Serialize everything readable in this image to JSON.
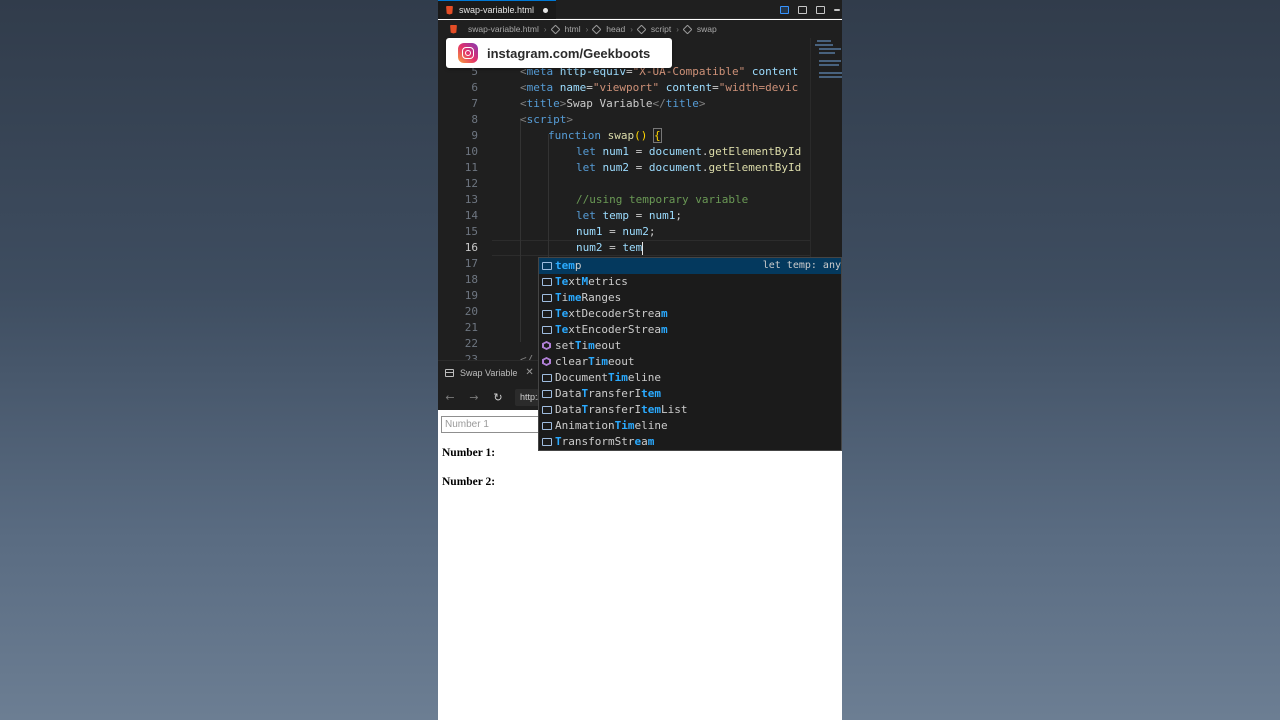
{
  "editor_tab": {
    "filename": "swap-variable.html"
  },
  "breadcrumbs": [
    "swap-variable.html",
    "html",
    "head",
    "script",
    "swap"
  ],
  "banner": {
    "text": "instagram.com/Geekboots"
  },
  "gutter": [
    "5",
    "6",
    "7",
    "8",
    "9",
    "10",
    "11",
    "12",
    "13",
    "14",
    "15",
    "16",
    "17",
    "18",
    "19",
    "20",
    "21",
    "22",
    "23"
  ],
  "code": {
    "l5": [
      "<",
      "meta",
      " ",
      "http-equiv",
      "=",
      "\"X-UA-Compatible\"",
      " ",
      "content"
    ],
    "l6": [
      "<",
      "meta",
      " ",
      "name",
      "=",
      "\"viewport\"",
      " ",
      "content",
      "=",
      "\"width=devic"
    ],
    "l7": [
      "<",
      "title",
      ">",
      "Swap Variable",
      "</",
      "title",
      ">"
    ],
    "l8": [
      "<",
      "script",
      ">"
    ],
    "l9": [
      "function",
      " ",
      "swap",
      "()",
      " ",
      "{"
    ],
    "l10": [
      "let",
      " ",
      "num1",
      " = ",
      "document",
      ".",
      "getElementById"
    ],
    "l11": [
      "let",
      " ",
      "num2",
      " = ",
      "document",
      ".",
      "getElementById"
    ],
    "l13": "//using temporary variable",
    "l14": [
      "let",
      " ",
      "temp",
      " = ",
      "num1",
      ";"
    ],
    "l15": [
      "num1",
      " = ",
      "num2",
      ";"
    ],
    "l16": [
      "num2",
      " = ",
      "tem"
    ],
    "l23": "</"
  },
  "suggestions": [
    {
      "parts": [
        "tem",
        "p"
      ],
      "icon": "variable-icon",
      "selected": true,
      "detail": "let temp: any"
    },
    {
      "parts": [
        "Te",
        "xt",
        "M",
        "etrics"
      ],
      "icon": "variable-icon"
    },
    {
      "parts": [
        "T",
        "i",
        "me",
        "Ranges"
      ],
      "icon": "variable-icon"
    },
    {
      "parts": [
        "Te",
        "xtDecoderStrea",
        "m"
      ],
      "icon": "variable-icon"
    },
    {
      "parts": [
        "Te",
        "xtEncoderStrea",
        "m"
      ],
      "icon": "variable-icon"
    },
    {
      "parts": [
        "set",
        "T",
        "i",
        "m",
        "e",
        "out"
      ],
      "icon": "method-icon"
    },
    {
      "parts": [
        "clear",
        "T",
        "i",
        "m",
        "e",
        "out"
      ],
      "icon": "method-icon"
    },
    {
      "parts": [
        "Document",
        "Tim",
        "e",
        "line"
      ],
      "icon": "variable-icon"
    },
    {
      "parts": [
        "Data",
        "T",
        "ransferI",
        "tem"
      ],
      "icon": "variable-icon"
    },
    {
      "parts": [
        "Data",
        "T",
        "ransferI",
        "tem",
        "List"
      ],
      "icon": "variable-icon"
    },
    {
      "parts": [
        "Animation",
        "Tim",
        "e",
        "line"
      ],
      "icon": "variable-icon"
    },
    {
      "parts": [
        "T",
        "ransformStr",
        "e",
        "a",
        "m"
      ],
      "icon": "variable-icon"
    }
  ],
  "browser": {
    "tab_title": "Swap Variable",
    "url": "http://",
    "input_placeholder": "Number 1",
    "label1": "Number 1:",
    "label2": "Number 2:"
  },
  "colors": {
    "accent": "#0078d4",
    "suggestion_highlight": "#2aaaff",
    "selected_row": "#04395e"
  }
}
